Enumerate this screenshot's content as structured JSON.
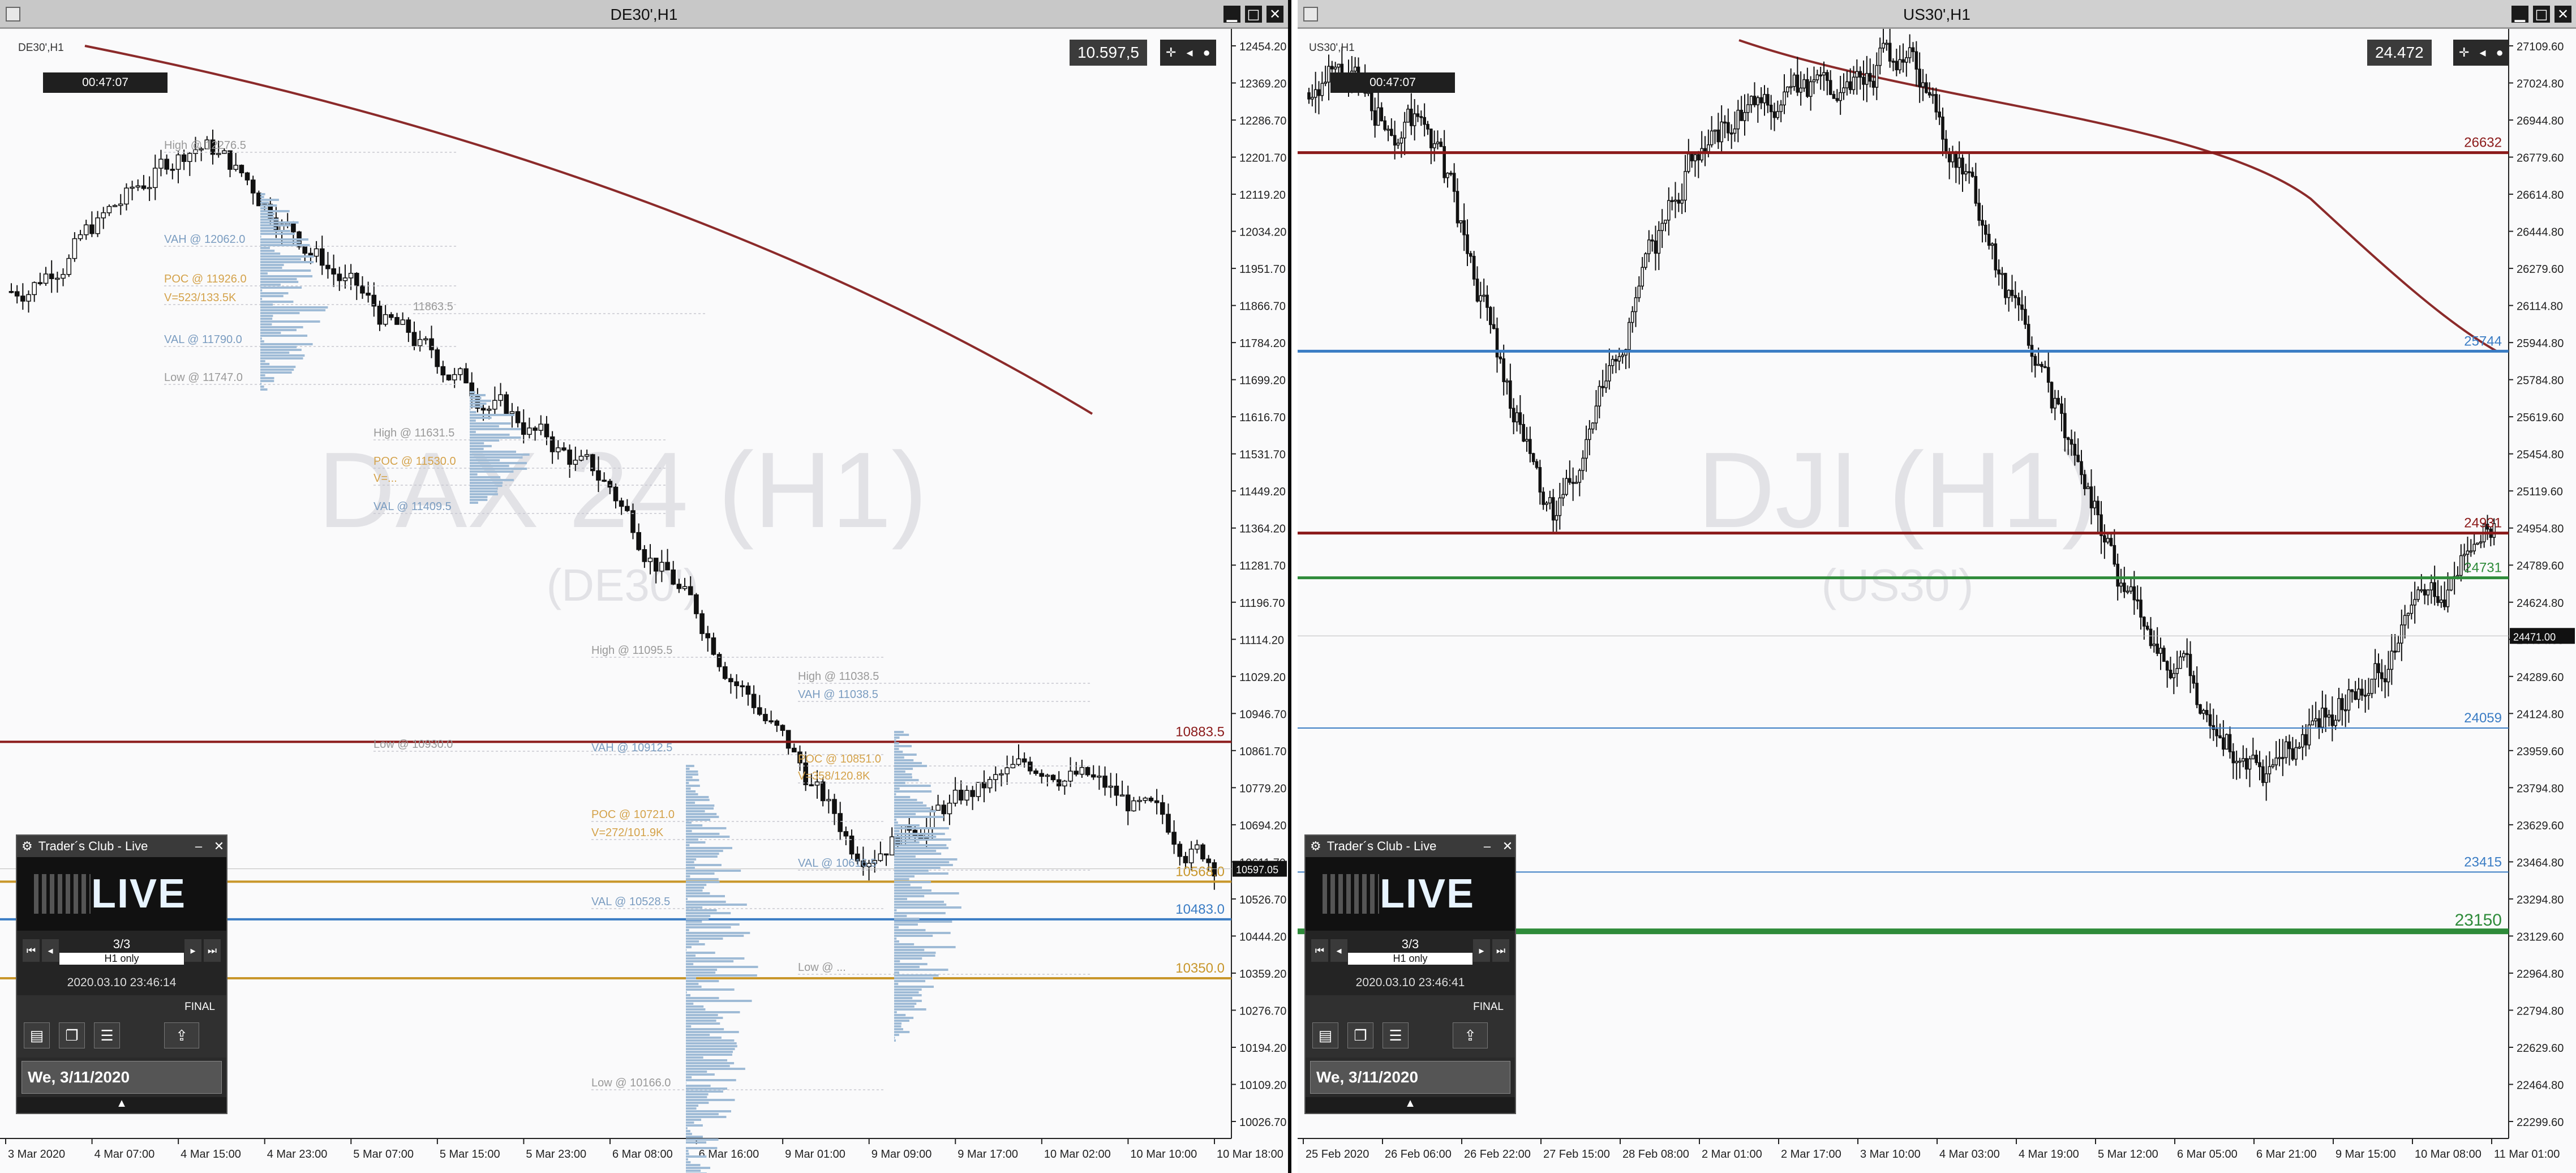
{
  "left": {
    "title": "DE30',H1",
    "symbol_label": "DE30',H1",
    "price_box": "10.597,5",
    "timer": "00:47:07",
    "watermark_main": "DAX 24 (H1)",
    "watermark_sub": "(DE30')",
    "y_axis": [
      "12454.20",
      "12369.20",
      "12286.70",
      "12201.70",
      "12119.20",
      "12034.20",
      "11951.70",
      "11866.70",
      "11784.20",
      "11699.20",
      "11616.70",
      "11531.70",
      "11449.20",
      "11364.20",
      "11281.70",
      "11196.70",
      "11114.20",
      "11029.20",
      "10946.70",
      "10861.70",
      "10779.20",
      "10694.20",
      "10611.70",
      "10526.70",
      "10444.20",
      "10359.20",
      "10276.70",
      "10194.20",
      "10109.20",
      "10026.70"
    ],
    "x_axis": [
      "3 Mar 2020",
      "4 Mar 07:00",
      "4 Mar 15:00",
      "4 Mar 23:00",
      "5 Mar 07:00",
      "5 Mar 15:00",
      "5 Mar 23:00",
      "6 Mar 08:00",
      "6 Mar 16:00",
      "9 Mar 01:00",
      "9 Mar 09:00",
      "9 Mar 17:00",
      "10 Mar 02:00",
      "10 Mar 10:00",
      "10 Mar 18:00"
    ],
    "current_price": "10597.05",
    "levels": [
      {
        "label": "10883.5",
        "color": "#8b1a1a",
        "value": 10883.5
      },
      {
        "label": "10568.0",
        "color": "#c8962a",
        "value": 10568.0
      },
      {
        "label": "10483.0",
        "color": "#3a7cc4",
        "value": 10483.0
      },
      {
        "label": "10350.0",
        "color": "#c8962a",
        "value": 10350.0
      }
    ],
    "profile_labels": [
      {
        "t": "High @ 12276.5",
        "c": "#999"
      },
      {
        "t": "VAH @ 12062.0",
        "c": "#7a9cc0"
      },
      {
        "t": "POC @ 11926.0",
        "c": "#d4a24a"
      },
      {
        "t": "V=523/133.5K",
        "c": "#d4a24a"
      },
      {
        "t": "VAL @ 11790.0",
        "c": "#7a9cc0"
      },
      {
        "t": "Low @ 11747.0",
        "c": "#999"
      },
      {
        "t": "11863.5",
        "c": "#999"
      },
      {
        "t": "High @ 11631.5",
        "c": "#999"
      },
      {
        "t": "POC @ 11530.0",
        "c": "#d4a24a"
      },
      {
        "t": "V=...",
        "c": "#d4a24a"
      },
      {
        "t": "VAL @ 11409.5",
        "c": "#7a9cc0"
      },
      {
        "t": "Low @ 10930.0",
        "c": "#999"
      },
      {
        "t": "High @ 11095.5",
        "c": "#999"
      },
      {
        "t": "VAH @ 10912.5",
        "c": "#7a9cc0"
      },
      {
        "t": "POC @ 10721.0",
        "c": "#d4a24a"
      },
      {
        "t": "V=272/101.9K",
        "c": "#d4a24a"
      },
      {
        "t": "VAL @ 10528.5",
        "c": "#7a9cc0"
      },
      {
        "t": "Low @ 10166.0",
        "c": "#999"
      },
      {
        "t": "High @ 11038.5",
        "c": "#999"
      },
      {
        "t": "VAH @ 11038.5",
        "c": "#7a9cc0"
      },
      {
        "t": "POC @ 10851.0",
        "c": "#d4a24a"
      },
      {
        "t": "V=358/120.8K",
        "c": "#d4a24a"
      },
      {
        "t": "VAL @ 10616.5",
        "c": "#7a9cc0"
      },
      {
        "t": "Low @ ...",
        "c": "#999"
      }
    ],
    "panel": {
      "title": "Trader´s Club - Live",
      "logo": "LIVE",
      "page": "3/3",
      "filter": "H1 only",
      "timestamp": "2020.03.10 23:46:14",
      "final": "FINAL",
      "date": "We, 3/11/2020"
    }
  },
  "right": {
    "title": "US30',H1",
    "symbol_label": "US30',H1",
    "price_box": "24.472",
    "timer": "00:47:07",
    "watermark_main": "DJI (H1)",
    "watermark_sub": "(US30')",
    "y_axis": [
      "27109.60",
      "27024.80",
      "26944.80",
      "26779.60",
      "26614.80",
      "26444.80",
      "26279.60",
      "26114.80",
      "25944.80",
      "25784.80",
      "25619.60",
      "25454.80",
      "25119.60",
      "24954.80",
      "24789.60",
      "24624.80",
      "24454.80",
      "24289.60",
      "24124.80",
      "23959.60",
      "23794.80",
      "23629.60",
      "23464.80",
      "23294.80",
      "23129.60",
      "22964.80",
      "22794.80",
      "22629.60",
      "22464.80",
      "22299.60"
    ],
    "x_axis": [
      "25 Feb 2020",
      "26 Feb 06:00",
      "26 Feb 22:00",
      "27 Feb 15:00",
      "28 Feb 08:00",
      "2 Mar 01:00",
      "2 Mar 17:00",
      "3 Mar 10:00",
      "4 Mar 03:00",
      "4 Mar 19:00",
      "5 Mar 12:00",
      "6 Mar 05:00",
      "6 Mar 21:00",
      "9 Mar 15:00",
      "10 Mar 08:00",
      "11 Mar 01:00"
    ],
    "current_price": "24471.00",
    "levels": [
      {
        "label": "26632",
        "color": "#8b1a1a",
        "value": 26632
      },
      {
        "label": "25744",
        "color": "#3a7cc4",
        "value": 25744
      },
      {
        "label": "24931",
        "color": "#8b1a1a",
        "value": 24931
      },
      {
        "label": "24731",
        "color": "#2e8b3a",
        "value": 24731
      },
      {
        "label": "24059",
        "color": "#3a7cc4",
        "value": 24059
      },
      {
        "label": "23415",
        "color": "#3a7cc4",
        "value": 23415
      },
      {
        "label": "23150",
        "color": "#2e8b3a",
        "value": 23150
      }
    ],
    "panel": {
      "title": "Trader´s Club - Live",
      "logo": "LIVE",
      "page": "3/3",
      "filter": "H1 only",
      "timestamp": "2020.03.10 23:46:41",
      "final": "FINAL",
      "date": "We, 3/11/2020"
    }
  }
}
